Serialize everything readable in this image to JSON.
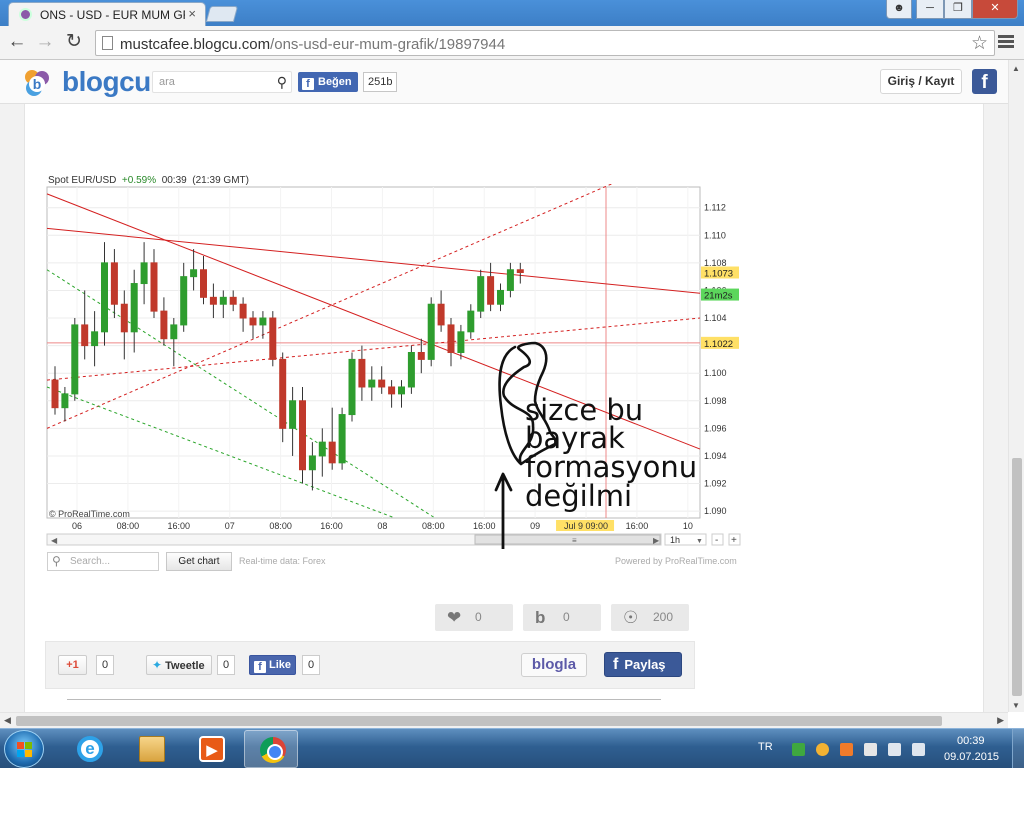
{
  "browser": {
    "tab_title": "ONS - USD - EUR MUM GRAFİĞİ",
    "tab_close": "×",
    "url_host": "mustcafee.blogcu.com",
    "url_path": "/ons-usd-eur-mum-grafik/19897944"
  },
  "site": {
    "logo": "blogcu",
    "search_placeholder": "ara",
    "like_label": "Beğen",
    "like_count": "251b",
    "login_label": "Giriş / Kayıt",
    "fb_label": "f"
  },
  "chart_info": {
    "instrument": "Spot EUR/USD",
    "change": "+0.59%",
    "time": "00:39",
    "gmt": "(21:39 GMT)"
  },
  "chart_data": {
    "type": "candlestick",
    "instrument": "Spot EUR/USD",
    "timeframe": "1h",
    "ylim": [
      1.0895,
      1.1135
    ],
    "yticks": [
      1.09,
      1.092,
      1.094,
      1.096,
      1.098,
      1.1,
      1.102,
      1.104,
      1.106,
      1.108,
      1.11,
      1.112
    ],
    "ytick_labels": [
      "1.090",
      "1.092",
      "1.094",
      "1.096",
      "1.098",
      "1.100",
      "1.102",
      "1.104",
      "1.106",
      "1.108",
      "1.110",
      "1.112"
    ],
    "xtick_labels": [
      "06",
      "08:00",
      "16:00",
      "07",
      "08:00",
      "16:00",
      "08",
      "08:00",
      "16:00",
      "09",
      "Jul 9 09:00",
      "16:00",
      "10"
    ],
    "current_price": "1.1073",
    "countdown": "21m2s",
    "marked_level": "1.1022",
    "watermark": "© ProRealTime.com",
    "timeframe_options": [
      "1h"
    ],
    "candles": [
      {
        "o": 1.0995,
        "h": 1.1005,
        "l": 1.097,
        "c": 1.0975
      },
      {
        "o": 1.0975,
        "h": 1.099,
        "l": 1.0965,
        "c": 1.0985
      },
      {
        "o": 1.0985,
        "h": 1.104,
        "l": 1.098,
        "c": 1.1035
      },
      {
        "o": 1.1035,
        "h": 1.106,
        "l": 1.101,
        "c": 1.102
      },
      {
        "o": 1.102,
        "h": 1.1045,
        "l": 1.1005,
        "c": 1.103
      },
      {
        "o": 1.103,
        "h": 1.1095,
        "l": 1.102,
        "c": 1.108
      },
      {
        "o": 1.108,
        "h": 1.109,
        "l": 1.104,
        "c": 1.105
      },
      {
        "o": 1.105,
        "h": 1.106,
        "l": 1.101,
        "c": 1.103
      },
      {
        "o": 1.103,
        "h": 1.1075,
        "l": 1.1015,
        "c": 1.1065
      },
      {
        "o": 1.1065,
        "h": 1.1095,
        "l": 1.105,
        "c": 1.108
      },
      {
        "o": 1.108,
        "h": 1.109,
        "l": 1.104,
        "c": 1.1045
      },
      {
        "o": 1.1045,
        "h": 1.1055,
        "l": 1.102,
        "c": 1.1025
      },
      {
        "o": 1.1025,
        "h": 1.104,
        "l": 1.1005,
        "c": 1.1035
      },
      {
        "o": 1.1035,
        "h": 1.108,
        "l": 1.103,
        "c": 1.107
      },
      {
        "o": 1.107,
        "h": 1.109,
        "l": 1.106,
        "c": 1.1075
      },
      {
        "o": 1.1075,
        "h": 1.1085,
        "l": 1.105,
        "c": 1.1055
      },
      {
        "o": 1.1055,
        "h": 1.1065,
        "l": 1.104,
        "c": 1.105
      },
      {
        "o": 1.105,
        "h": 1.106,
        "l": 1.104,
        "c": 1.1055
      },
      {
        "o": 1.1055,
        "h": 1.106,
        "l": 1.1045,
        "c": 1.105
      },
      {
        "o": 1.105,
        "h": 1.1055,
        "l": 1.103,
        "c": 1.104
      },
      {
        "o": 1.104,
        "h": 1.1045,
        "l": 1.1025,
        "c": 1.1035
      },
      {
        "o": 1.1035,
        "h": 1.1045,
        "l": 1.1025,
        "c": 1.104
      },
      {
        "o": 1.104,
        "h": 1.1045,
        "l": 1.1005,
        "c": 1.101
      },
      {
        "o": 1.101,
        "h": 1.1015,
        "l": 1.095,
        "c": 1.096
      },
      {
        "o": 1.096,
        "h": 1.099,
        "l": 1.094,
        "c": 1.098
      },
      {
        "o": 1.098,
        "h": 1.099,
        "l": 1.092,
        "c": 1.093
      },
      {
        "o": 1.093,
        "h": 1.095,
        "l": 1.0915,
        "c": 1.094
      },
      {
        "o": 1.094,
        "h": 1.096,
        "l": 1.0925,
        "c": 1.095
      },
      {
        "o": 1.095,
        "h": 1.0975,
        "l": 1.093,
        "c": 1.0935
      },
      {
        "o": 1.0935,
        "h": 1.0975,
        "l": 1.093,
        "c": 1.097
      },
      {
        "o": 1.097,
        "h": 1.1015,
        "l": 1.0965,
        "c": 1.101
      },
      {
        "o": 1.101,
        "h": 1.102,
        "l": 1.098,
        "c": 1.099
      },
      {
        "o": 1.099,
        "h": 1.1005,
        "l": 1.098,
        "c": 1.0995
      },
      {
        "o": 1.0995,
        "h": 1.1005,
        "l": 1.0985,
        "c": 1.099
      },
      {
        "o": 1.099,
        "h": 1.0995,
        "l": 1.0975,
        "c": 1.0985
      },
      {
        "o": 1.0985,
        "h": 1.0995,
        "l": 1.0975,
        "c": 1.099
      },
      {
        "o": 1.099,
        "h": 1.102,
        "l": 1.0985,
        "c": 1.1015
      },
      {
        "o": 1.1015,
        "h": 1.1025,
        "l": 1.1,
        "c": 1.101
      },
      {
        "o": 1.101,
        "h": 1.1055,
        "l": 1.1005,
        "c": 1.105
      },
      {
        "o": 1.105,
        "h": 1.106,
        "l": 1.103,
        "c": 1.1035
      },
      {
        "o": 1.1035,
        "h": 1.104,
        "l": 1.1005,
        "c": 1.1015
      },
      {
        "o": 1.1015,
        "h": 1.1035,
        "l": 1.101,
        "c": 1.103
      },
      {
        "o": 1.103,
        "h": 1.105,
        "l": 1.1025,
        "c": 1.1045
      },
      {
        "o": 1.1045,
        "h": 1.1075,
        "l": 1.104,
        "c": 1.107
      },
      {
        "o": 1.107,
        "h": 1.108,
        "l": 1.1045,
        "c": 1.105
      },
      {
        "o": 1.105,
        "h": 1.1065,
        "l": 1.1045,
        "c": 1.106
      },
      {
        "o": 1.106,
        "h": 1.108,
        "l": 1.1055,
        "c": 1.1075
      },
      {
        "o": 1.1075,
        "h": 1.108,
        "l": 1.1065,
        "c": 1.1073
      }
    ]
  },
  "annotation": {
    "line1": "sizce bu",
    "line2": "bayrak",
    "line3": "formasyonu",
    "line4": "değilmi"
  },
  "chart_controls": {
    "search_placeholder": "Search...",
    "get_chart": "Get chart",
    "realtime": "Real-time data: Forex",
    "powered": "Powered by ProRealTime.com"
  },
  "stats": {
    "likes": "0",
    "blogs": "0",
    "views": "200"
  },
  "share": {
    "gplus_label": "+1",
    "gplus_count": "0",
    "tweet_label": "Tweetle",
    "tweet_count": "0",
    "fb_like_label": "Like",
    "fb_like_count": "0",
    "blogla_label": "blogla",
    "paylas_label": "Paylaş"
  },
  "taskbar": {
    "language": "TR",
    "time": "00:39",
    "date": "09.07.2015"
  },
  "colors": {
    "bull": "#2e9d2e",
    "bear": "#c0392b",
    "trendline": "#d42020",
    "fibline": "#2aa52a",
    "price_tag": "#ffe066",
    "countdown_tag": "#5cd65c",
    "brand": "#3b79c4",
    "facebook": "#3b5998"
  }
}
